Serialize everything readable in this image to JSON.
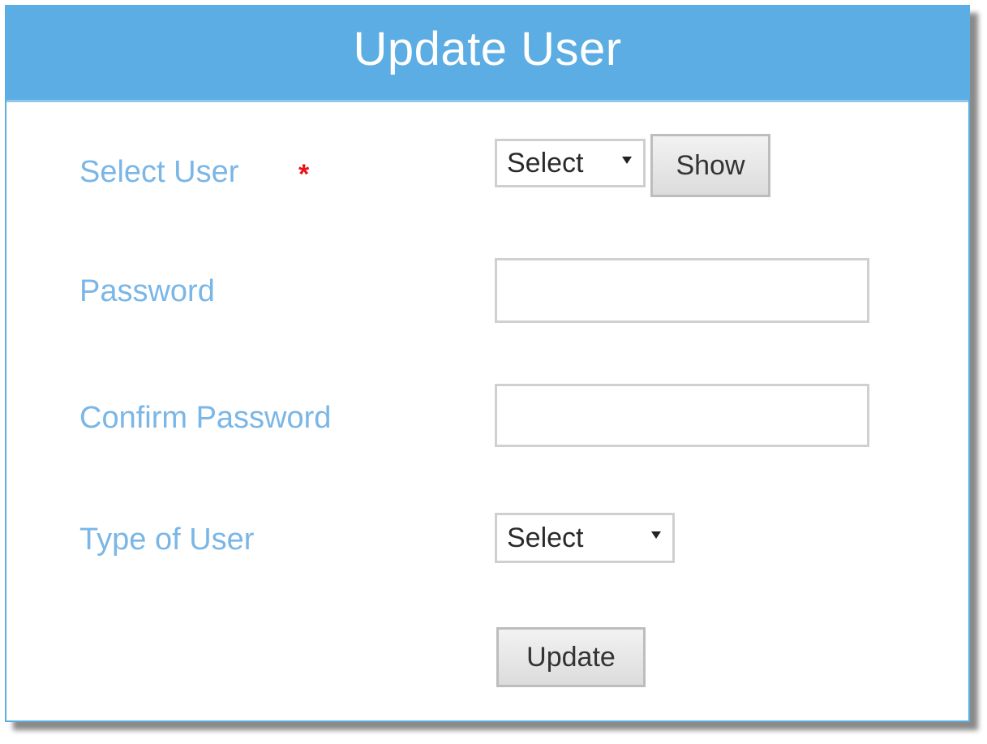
{
  "form": {
    "title": "Update User",
    "select_user": {
      "label": "Select User",
      "required_mark": "*",
      "selected": "Select",
      "show_button": "Show"
    },
    "password": {
      "label": "Password",
      "value": ""
    },
    "confirm_password": {
      "label": "Confirm Password",
      "value": ""
    },
    "user_type": {
      "label": "Type of User",
      "selected": "Select"
    },
    "update_button": "Update"
  },
  "colors": {
    "header_bg": "#5cade3",
    "label_text": "#7ab6e6",
    "required": "#e8121c",
    "panel_border": "#5aaee3"
  }
}
